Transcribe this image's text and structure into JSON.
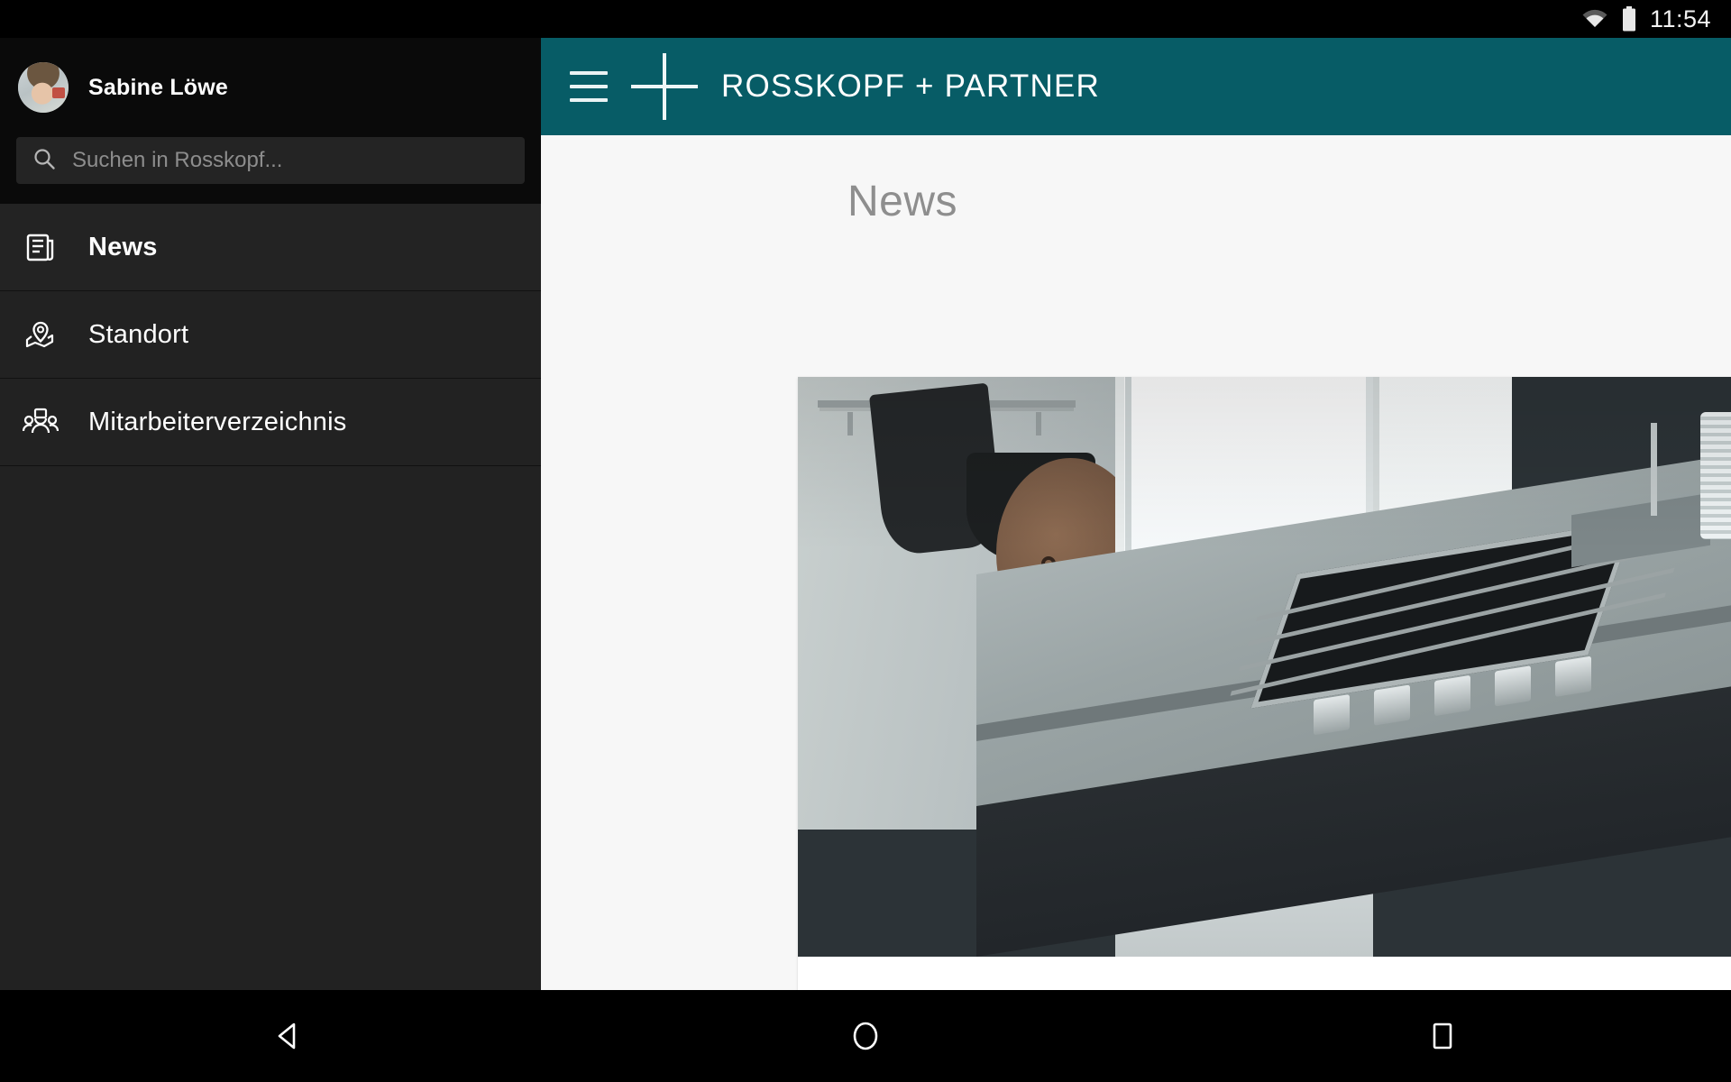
{
  "status_bar": {
    "time": "11:54",
    "wifi_icon": "wifi-icon",
    "battery_icon": "battery-icon"
  },
  "sidebar": {
    "profile": {
      "name": "Sabine Löwe",
      "avatar_icon": "avatar"
    },
    "search": {
      "placeholder": "Suchen in Rosskopf...",
      "value": "",
      "icon": "search-icon"
    },
    "items": [
      {
        "label": "News",
        "icon": "newspaper-icon",
        "active": true
      },
      {
        "label": "Standort",
        "icon": "map-pin-icon",
        "active": false
      },
      {
        "label": "Mitarbeiterverzeichnis",
        "icon": "people-group-icon",
        "active": false
      }
    ]
  },
  "appbar": {
    "menu_icon": "hamburger-menu-icon",
    "logo_icon": "plus-logo-icon",
    "title": "ROSSKOPF + PARTNER",
    "background_color": "#075c66"
  },
  "main": {
    "page_title": "News",
    "news_card": {
      "image_alt": "kitchen-photo"
    }
  },
  "android_nav": {
    "back": "back-triangle-icon",
    "home": "home-circle-icon",
    "recents": "recents-square-icon"
  },
  "colors": {
    "accent_teal": "#075c66",
    "sidebar_bg": "#0a0a0a",
    "nav_item_bg": "#222222",
    "nav_item_active_bg": "#232323",
    "content_bg": "#f7f7f7",
    "title_gray": "#8e8e8e"
  }
}
